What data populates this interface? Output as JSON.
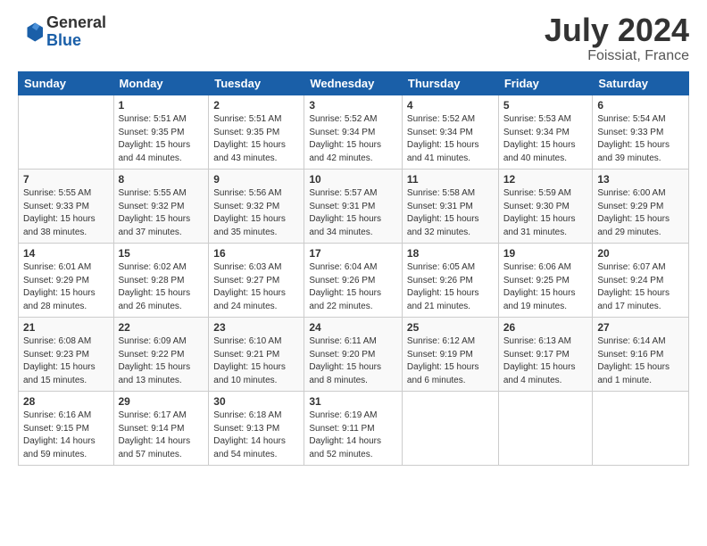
{
  "header": {
    "logo_general": "General",
    "logo_blue": "Blue",
    "month_year": "July 2024",
    "location": "Foissiat, France"
  },
  "days_of_week": [
    "Sunday",
    "Monday",
    "Tuesday",
    "Wednesday",
    "Thursday",
    "Friday",
    "Saturday"
  ],
  "weeks": [
    [
      {
        "day": "",
        "info": ""
      },
      {
        "day": "1",
        "info": "Sunrise: 5:51 AM\nSunset: 9:35 PM\nDaylight: 15 hours\nand 44 minutes."
      },
      {
        "day": "2",
        "info": "Sunrise: 5:51 AM\nSunset: 9:35 PM\nDaylight: 15 hours\nand 43 minutes."
      },
      {
        "day": "3",
        "info": "Sunrise: 5:52 AM\nSunset: 9:34 PM\nDaylight: 15 hours\nand 42 minutes."
      },
      {
        "day": "4",
        "info": "Sunrise: 5:52 AM\nSunset: 9:34 PM\nDaylight: 15 hours\nand 41 minutes."
      },
      {
        "day": "5",
        "info": "Sunrise: 5:53 AM\nSunset: 9:34 PM\nDaylight: 15 hours\nand 40 minutes."
      },
      {
        "day": "6",
        "info": "Sunrise: 5:54 AM\nSunset: 9:33 PM\nDaylight: 15 hours\nand 39 minutes."
      }
    ],
    [
      {
        "day": "7",
        "info": "Sunrise: 5:55 AM\nSunset: 9:33 PM\nDaylight: 15 hours\nand 38 minutes."
      },
      {
        "day": "8",
        "info": "Sunrise: 5:55 AM\nSunset: 9:32 PM\nDaylight: 15 hours\nand 37 minutes."
      },
      {
        "day": "9",
        "info": "Sunrise: 5:56 AM\nSunset: 9:32 PM\nDaylight: 15 hours\nand 35 minutes."
      },
      {
        "day": "10",
        "info": "Sunrise: 5:57 AM\nSunset: 9:31 PM\nDaylight: 15 hours\nand 34 minutes."
      },
      {
        "day": "11",
        "info": "Sunrise: 5:58 AM\nSunset: 9:31 PM\nDaylight: 15 hours\nand 32 minutes."
      },
      {
        "day": "12",
        "info": "Sunrise: 5:59 AM\nSunset: 9:30 PM\nDaylight: 15 hours\nand 31 minutes."
      },
      {
        "day": "13",
        "info": "Sunrise: 6:00 AM\nSunset: 9:29 PM\nDaylight: 15 hours\nand 29 minutes."
      }
    ],
    [
      {
        "day": "14",
        "info": "Sunrise: 6:01 AM\nSunset: 9:29 PM\nDaylight: 15 hours\nand 28 minutes."
      },
      {
        "day": "15",
        "info": "Sunrise: 6:02 AM\nSunset: 9:28 PM\nDaylight: 15 hours\nand 26 minutes."
      },
      {
        "day": "16",
        "info": "Sunrise: 6:03 AM\nSunset: 9:27 PM\nDaylight: 15 hours\nand 24 minutes."
      },
      {
        "day": "17",
        "info": "Sunrise: 6:04 AM\nSunset: 9:26 PM\nDaylight: 15 hours\nand 22 minutes."
      },
      {
        "day": "18",
        "info": "Sunrise: 6:05 AM\nSunset: 9:26 PM\nDaylight: 15 hours\nand 21 minutes."
      },
      {
        "day": "19",
        "info": "Sunrise: 6:06 AM\nSunset: 9:25 PM\nDaylight: 15 hours\nand 19 minutes."
      },
      {
        "day": "20",
        "info": "Sunrise: 6:07 AM\nSunset: 9:24 PM\nDaylight: 15 hours\nand 17 minutes."
      }
    ],
    [
      {
        "day": "21",
        "info": "Sunrise: 6:08 AM\nSunset: 9:23 PM\nDaylight: 15 hours\nand 15 minutes."
      },
      {
        "day": "22",
        "info": "Sunrise: 6:09 AM\nSunset: 9:22 PM\nDaylight: 15 hours\nand 13 minutes."
      },
      {
        "day": "23",
        "info": "Sunrise: 6:10 AM\nSunset: 9:21 PM\nDaylight: 15 hours\nand 10 minutes."
      },
      {
        "day": "24",
        "info": "Sunrise: 6:11 AM\nSunset: 9:20 PM\nDaylight: 15 hours\nand 8 minutes."
      },
      {
        "day": "25",
        "info": "Sunrise: 6:12 AM\nSunset: 9:19 PM\nDaylight: 15 hours\nand 6 minutes."
      },
      {
        "day": "26",
        "info": "Sunrise: 6:13 AM\nSunset: 9:17 PM\nDaylight: 15 hours\nand 4 minutes."
      },
      {
        "day": "27",
        "info": "Sunrise: 6:14 AM\nSunset: 9:16 PM\nDaylight: 15 hours\nand 1 minute."
      }
    ],
    [
      {
        "day": "28",
        "info": "Sunrise: 6:16 AM\nSunset: 9:15 PM\nDaylight: 14 hours\nand 59 minutes."
      },
      {
        "day": "29",
        "info": "Sunrise: 6:17 AM\nSunset: 9:14 PM\nDaylight: 14 hours\nand 57 minutes."
      },
      {
        "day": "30",
        "info": "Sunrise: 6:18 AM\nSunset: 9:13 PM\nDaylight: 14 hours\nand 54 minutes."
      },
      {
        "day": "31",
        "info": "Sunrise: 6:19 AM\nSunset: 9:11 PM\nDaylight: 14 hours\nand 52 minutes."
      },
      {
        "day": "",
        "info": ""
      },
      {
        "day": "",
        "info": ""
      },
      {
        "day": "",
        "info": ""
      }
    ]
  ]
}
